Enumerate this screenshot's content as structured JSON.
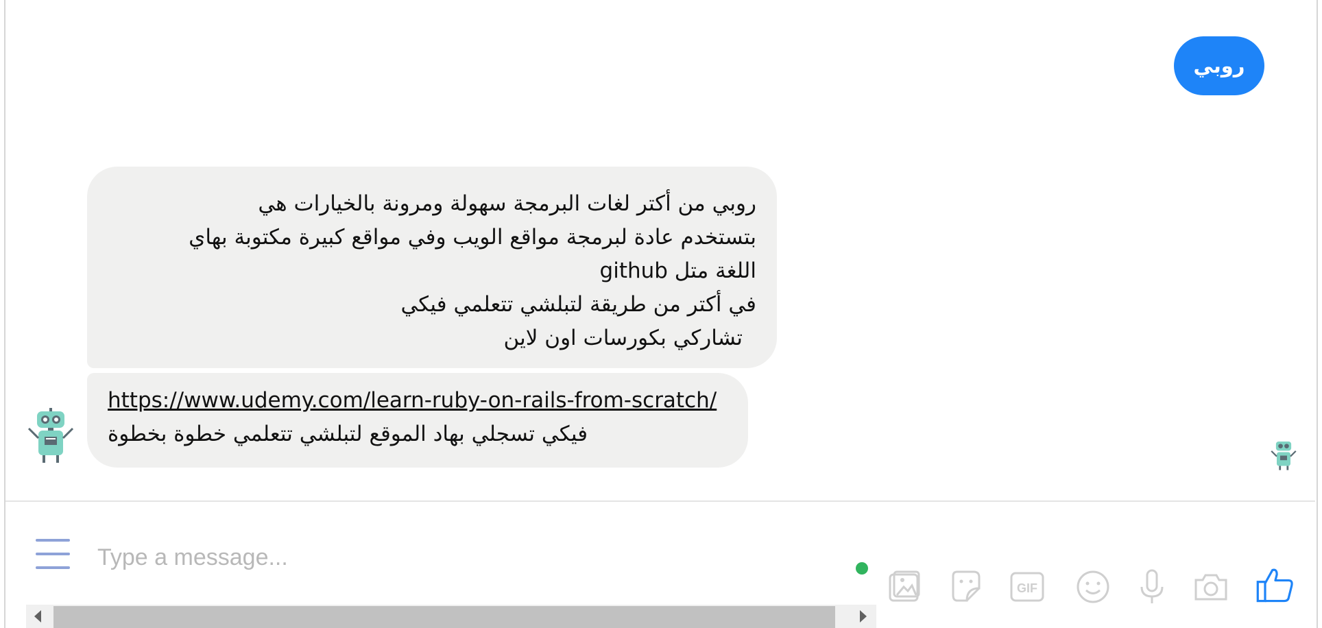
{
  "colors": {
    "sent_bubble": "#1e84f8",
    "received_bubble": "#f0f0ef",
    "composer_icons": "#cfcfcf",
    "like_icon": "#1e84f8",
    "menu_icon": "#8ea2d8",
    "online_dot": "#31b45e"
  },
  "conversation": {
    "sent_message": "روبي",
    "received_messages": [
      {
        "lines": [
          "روبي من أكتر لغات البرمجة سهولة ومرونة بالخيارات هي",
          "بتستخدم عادة لبرمجة مواقع الويب وفي مواقع كبيرة مكتوبة بهاي",
          "اللغة متل github",
          "في أكتر من طريقة لتبلشي تتعلمي فيكي",
          "تشاركي بكورسات اون لاين"
        ]
      },
      {
        "link": "https://www.udemy.com/learn-ruby-on-rails-from-scratch/",
        "text": "فيكي تسجلي بهاد الموقع لتبلشي تتعلمي خطوة بخطوة"
      }
    ],
    "avatar_icon": "robot-icon",
    "seen_icon": "robot-icon"
  },
  "composer": {
    "menu_icon": "menu-icon",
    "placeholder": "Type a message...",
    "tools": [
      {
        "name": "image-icon"
      },
      {
        "name": "sticker-icon"
      },
      {
        "name": "gif-icon",
        "label": "GIF"
      },
      {
        "name": "emoji-icon"
      },
      {
        "name": "microphone-icon"
      },
      {
        "name": "camera-icon"
      },
      {
        "name": "like-icon"
      }
    ]
  }
}
